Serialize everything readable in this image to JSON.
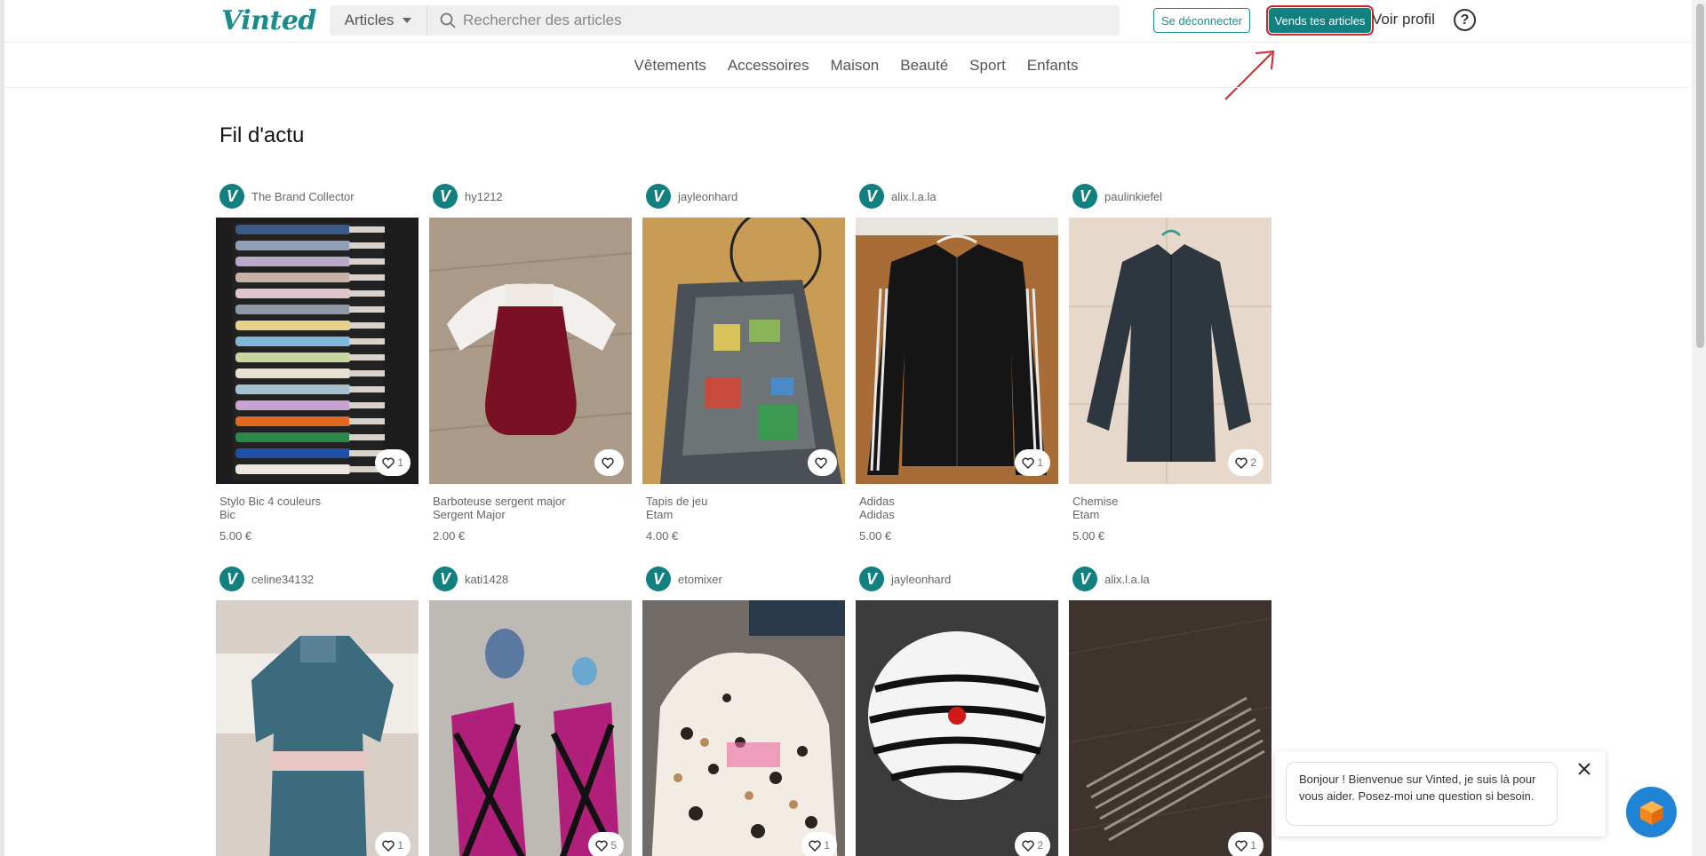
{
  "header": {
    "logo": "Vinted",
    "search_category": "Articles",
    "search_placeholder": "Rechercher des articles",
    "logout_label": "Se déconnecter",
    "sell_label": "Vends tes articles",
    "profile_label": "Voir profil",
    "help_symbol": "?"
  },
  "nav": {
    "categories": [
      "Vêtements",
      "Accessoires",
      "Maison",
      "Beauté",
      "Sport",
      "Enfants"
    ]
  },
  "feed": {
    "title": "Fil d'actu",
    "items": [
      {
        "seller": "The Brand Collector",
        "title": "Stylo Bic 4 couleurs",
        "brand": "Bic",
        "price": "5.00 €",
        "favs": "1"
      },
      {
        "seller": "hy1212",
        "title": "Barboteuse sergent major",
        "brand": "Sergent Major",
        "price": "2.00 €",
        "favs": ""
      },
      {
        "seller": "jayleonhard",
        "title": "Tapis de jeu",
        "brand": "Etam",
        "price": "4.00 €",
        "favs": ""
      },
      {
        "seller": "alix.l.a.la",
        "title": "Adidas",
        "brand": "Adidas",
        "price": "5.00 €",
        "favs": "1"
      },
      {
        "seller": "paulinkiefel",
        "title": "Chemise",
        "brand": "Etam",
        "price": "5.00 €",
        "favs": "2"
      },
      {
        "seller": "celine34132",
        "title": "",
        "brand": "",
        "price": "",
        "favs": "1"
      },
      {
        "seller": "kati1428",
        "title": "",
        "brand": "",
        "price": "",
        "favs": "5"
      },
      {
        "seller": "etomixer",
        "title": "",
        "brand": "",
        "price": "",
        "favs": "1"
      },
      {
        "seller": "jayleonhard",
        "title": "",
        "brand": "",
        "price": "",
        "favs": "2"
      },
      {
        "seller": "alix.l.a.la",
        "title": "",
        "brand": "",
        "price": "",
        "favs": "1"
      }
    ]
  },
  "chat": {
    "message": "Bonjour ! Bienvenue sur Vinted, je suis là pour vous aider. Posez-moi une question si besoin."
  },
  "colors": {
    "brand": "#138080",
    "annotation_red": "#d2232a",
    "chat_launcher": "#1f84d6"
  }
}
